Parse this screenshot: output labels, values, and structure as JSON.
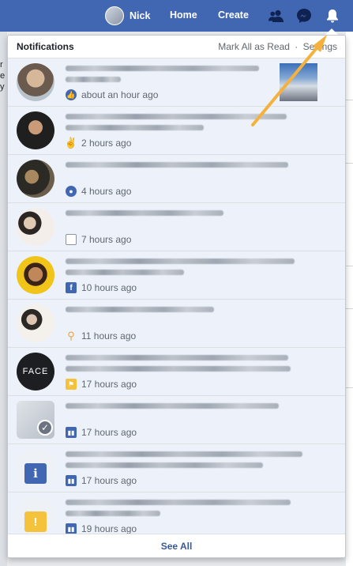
{
  "topbar": {
    "user_name": "Nick",
    "home_label": "Home",
    "create_label": "Create",
    "icons": [
      "friend-requests-icon",
      "messenger-icon",
      "notifications-bell-icon"
    ],
    "brand_color": "#4267b2"
  },
  "panel": {
    "title": "Notifications",
    "mark_all_read": "Mark All as Read",
    "separator": "·",
    "settings": "Settings",
    "see_all": "See All"
  },
  "notifications": [
    {
      "time": "about an hour ago",
      "type_icon": "like-icon",
      "icon_color": "#4267b2",
      "has_thumbnail": true
    },
    {
      "time": "2 hours ago",
      "type_icon": "rock-hand-icon",
      "icon_color": "#e4a442",
      "has_thumbnail": false
    },
    {
      "time": "4 hours ago",
      "type_icon": "group-icon",
      "icon_color": "#4267b2",
      "has_thumbnail": false
    },
    {
      "time": "7 hours ago",
      "type_icon": "memory-icon",
      "icon_color": "#8d949e",
      "has_thumbnail": false
    },
    {
      "time": "10 hours ago",
      "type_icon": "facebook-icon",
      "icon_color": "#4267b2",
      "has_thumbnail": false
    },
    {
      "time": "11 hours ago",
      "type_icon": "location-pin-icon",
      "icon_color": "#e4a442",
      "has_thumbnail": false
    },
    {
      "time": "17 hours ago",
      "type_icon": "page-flag-icon",
      "icon_color": "#f5c33b",
      "has_thumbnail": false
    },
    {
      "time": "17 hours ago",
      "type_icon": "insights-icon",
      "icon_color": "#4267b2",
      "has_thumbnail": false
    },
    {
      "time": "17 hours ago",
      "type_icon": "insights-icon",
      "icon_color": "#4267b2",
      "has_thumbnail": false
    },
    {
      "time": "19 hours ago",
      "type_icon": "insights-icon",
      "icon_color": "#4267b2",
      "has_thumbnail": false
    }
  ],
  "avatar_text": "FACE",
  "background_left_letters": [
    "r",
    "e",
    "y"
  ],
  "accent_arrow_color": "#f5b13d"
}
